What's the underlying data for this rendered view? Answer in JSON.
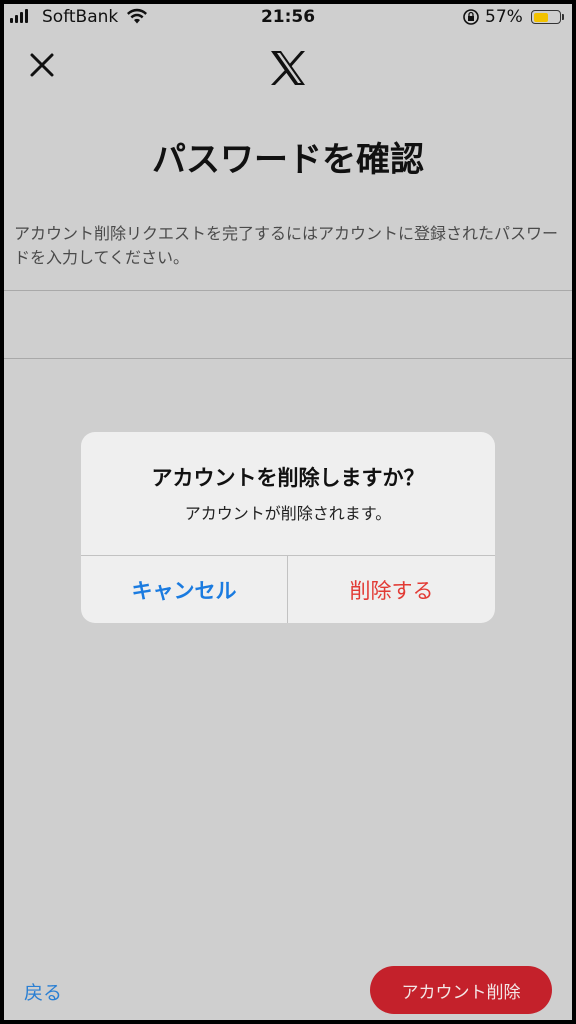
{
  "status_bar": {
    "carrier": "SoftBank",
    "time": "21:56",
    "battery_percent": "57%",
    "battery_level": 0.57,
    "signal_bars": 4
  },
  "nav": {
    "close_icon": "close-icon",
    "logo_icon": "x-logo-icon"
  },
  "page": {
    "title": "パスワードを確認",
    "description": "アカウント削除リクエストを完了するにはアカウントに登録されたパスワードを入力してください。",
    "password_value": ""
  },
  "alert": {
    "title": "アカウントを削除しますか？",
    "message": "アカウントが削除されます。",
    "cancel_label": "キャンセル",
    "delete_label": "削除する"
  },
  "bottom": {
    "back_label": "戻る",
    "delete_account_label": "アカウント削除"
  },
  "colors": {
    "overlay_bg": "#cfcfcf",
    "cancel_blue": "#1a7be0",
    "destructive_red": "#e23a34",
    "delete_button_bg": "#c4212b"
  }
}
